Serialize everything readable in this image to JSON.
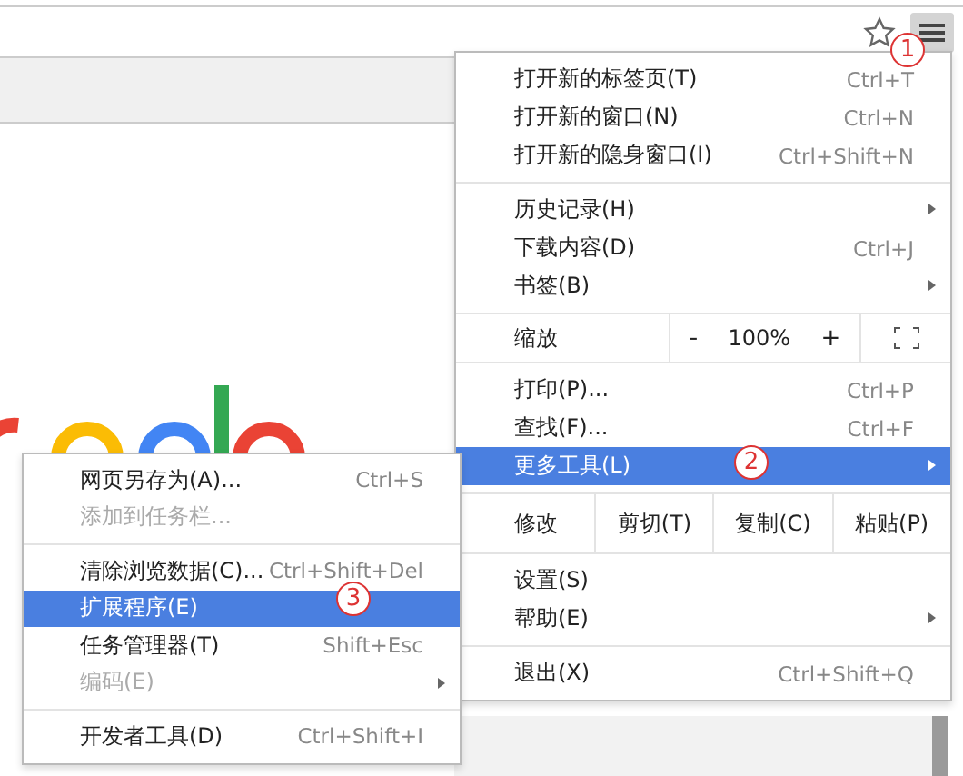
{
  "main_menu": {
    "groups": [
      [
        {
          "kind": "item",
          "label": "打开新的标签页(T)",
          "shortcut": "Ctrl+T",
          "submenu": false,
          "selected": false
        },
        {
          "kind": "item",
          "label": "打开新的窗口(N)",
          "shortcut": "Ctrl+N",
          "submenu": false,
          "selected": false
        },
        {
          "kind": "item",
          "label": "打开新的隐身窗口(I)",
          "shortcut": "Ctrl+Shift+N",
          "submenu": false,
          "selected": false
        }
      ],
      [
        {
          "kind": "item",
          "label": "历史记录(H)",
          "submenu": true,
          "selected": false
        },
        {
          "kind": "item",
          "label": "下载内容(D)",
          "shortcut": "Ctrl+J",
          "submenu": false,
          "selected": false
        },
        {
          "kind": "item",
          "label": "书签(B)",
          "submenu": true,
          "selected": false
        }
      ],
      [
        {
          "kind": "zoom",
          "label": "缩放",
          "minus": "-",
          "value": "100%",
          "plus": "+"
        }
      ],
      [
        {
          "kind": "item",
          "label": "打印(P)...",
          "shortcut": "Ctrl+P",
          "submenu": false,
          "selected": false
        },
        {
          "kind": "item",
          "label": "查找(F)...",
          "shortcut": "Ctrl+F",
          "submenu": false,
          "selected": false
        },
        {
          "kind": "item",
          "label": "更多工具(L)",
          "submenu": true,
          "selected": true
        }
      ],
      [
        {
          "kind": "edit",
          "label": "修改",
          "buttons": [
            "剪切(T)",
            "复制(C)",
            "粘贴(P)"
          ]
        }
      ],
      [
        {
          "kind": "item",
          "label": "设置(S)",
          "submenu": false,
          "selected": false
        },
        {
          "kind": "item",
          "label": "帮助(E)",
          "submenu": true,
          "selected": false
        }
      ],
      [
        {
          "kind": "item",
          "label": "退出(X)",
          "shortcut": "Ctrl+Shift+Q",
          "submenu": false,
          "selected": false
        }
      ]
    ]
  },
  "submenu": {
    "groups": [
      [
        {
          "label": "网页另存为(A)...",
          "shortcut": "Ctrl+S",
          "submenu": false,
          "disabled": false,
          "selected": false
        },
        {
          "label": "添加到任务栏...",
          "submenu": false,
          "disabled": true,
          "selected": false
        }
      ],
      [
        {
          "label": "清除浏览数据(C)...",
          "shortcut": "Ctrl+Shift+Del",
          "submenu": false,
          "disabled": false,
          "selected": false
        },
        {
          "label": "扩展程序(E)",
          "submenu": false,
          "disabled": false,
          "selected": true
        },
        {
          "label": "任务管理器(T)",
          "shortcut": "Shift+Esc",
          "submenu": false,
          "disabled": false,
          "selected": false
        },
        {
          "label": "编码(E)",
          "submenu": true,
          "disabled": true,
          "selected": false
        }
      ],
      [
        {
          "label": "开发者工具(D)",
          "shortcut": "Ctrl+Shift+I",
          "submenu": false,
          "disabled": false,
          "selected": false
        }
      ]
    ]
  },
  "callouts": [
    "1",
    "2",
    "3"
  ]
}
